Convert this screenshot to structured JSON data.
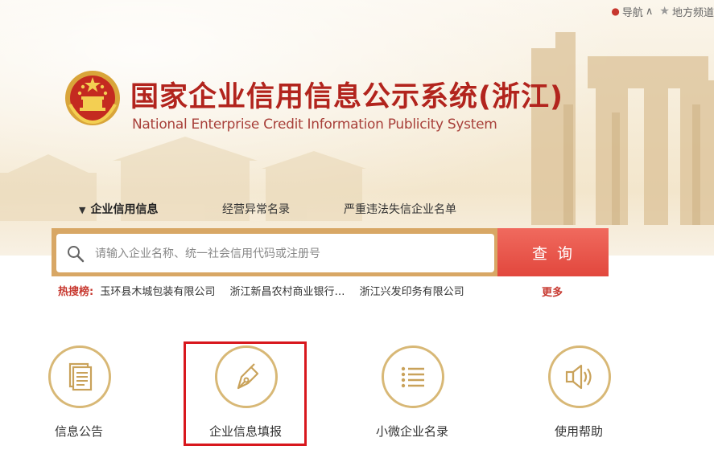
{
  "top_links": {
    "nav_label": "导航",
    "nav_arrow": "∧",
    "local_label": "地方频道"
  },
  "header": {
    "title_cn": "国家企业信用信息公示系统(浙江)",
    "title_en": "National Enterprise Credit Information Publicity System"
  },
  "tabs": [
    {
      "label": "企业信用信息",
      "active": true
    },
    {
      "label": "经营异常名录",
      "active": false
    },
    {
      "label": "严重违法失信企业名单",
      "active": false
    }
  ],
  "search": {
    "placeholder": "请输入企业名称、统一社会信用代码或注册号",
    "button_label": "查询"
  },
  "hot_search": {
    "label": "热搜榜:",
    "items": [
      "玉环县木城包装有限公司",
      "浙江新昌农村商业银行…",
      "浙江兴发印务有限公司"
    ],
    "more_label": "更多"
  },
  "features": [
    {
      "label": "信息公告",
      "icon": "document-icon"
    },
    {
      "label": "企业信息填报",
      "icon": "pen-icon",
      "highlighted": true
    },
    {
      "label": "小微企业名录",
      "icon": "list-icon"
    },
    {
      "label": "使用帮助",
      "icon": "speaker-icon"
    }
  ],
  "colors": {
    "brand_red": "#b2241d",
    "search_button": "#e2473d",
    "gold_border": "#d8b876",
    "highlight": "#d8171d"
  }
}
